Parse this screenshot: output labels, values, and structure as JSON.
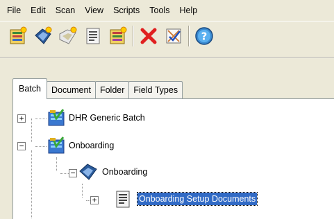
{
  "menu": [
    "File",
    "Edit",
    "Scan",
    "View",
    "Scripts",
    "Tools",
    "Help"
  ],
  "toolbar": {
    "icons": [
      "new-batch-icon",
      "new-document-icon",
      "new-folder-icon",
      "properties-icon",
      "scan-icon",
      "delete-icon",
      "validate-icon",
      "help-icon"
    ]
  },
  "tabs": [
    "Batch",
    "Document",
    "Folder",
    "Field Types"
  ],
  "active_tab": "Batch",
  "tree": {
    "nodes": [
      {
        "label": "DHR Generic Batch",
        "expander": "+"
      },
      {
        "label": "Onboarding",
        "expander": "−"
      },
      {
        "label": "Onboarding",
        "expander": "−"
      },
      {
        "label": "Onboarding Setup Documents",
        "expander": "+"
      }
    ]
  },
  "colors": {
    "selection": "#316ac5",
    "window_bg": "#ece9d8"
  }
}
